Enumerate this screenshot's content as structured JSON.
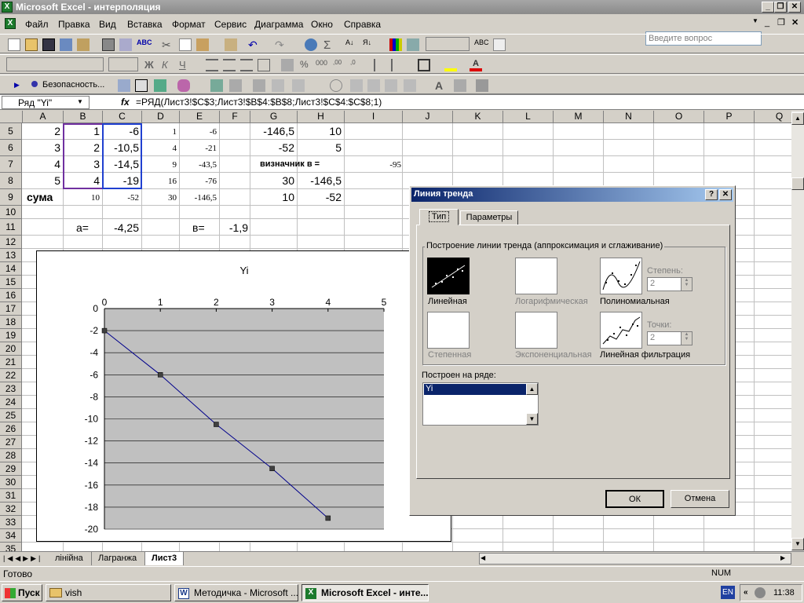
{
  "window": {
    "title": "Microsoft Excel - интерполяция"
  },
  "menu": [
    "Файл",
    "Правка",
    "Вид",
    "Вставка",
    "Формат",
    "Сервис",
    "Диаграмма",
    "Окно",
    "Справка"
  ],
  "help_placeholder": "Введите вопрос",
  "toolbar3": {
    "security": "Безопасность..."
  },
  "formula_bar": {
    "name": "Ряд \"Yi\"",
    "fx": "fx",
    "formula": "=РЯД(Лист3!$C$3;Лист3!$B$4:$B$8;Лист3!$C$4:$C$8;1)"
  },
  "columns": [
    "A",
    "B",
    "C",
    "D",
    "E",
    "F",
    "G",
    "H",
    "I",
    "J",
    "K",
    "L",
    "M",
    "N",
    "O",
    "P",
    "Q"
  ],
  "rows": [
    "5",
    "6",
    "7",
    "8",
    "9",
    "10",
    "11",
    "12",
    "13",
    "14",
    "15",
    "16",
    "17",
    "18",
    "19",
    "20",
    "21",
    "22",
    "23",
    "24",
    "25",
    "26",
    "27",
    "28",
    "29",
    "30",
    "31",
    "32",
    "33",
    "34",
    "35"
  ],
  "cells": {
    "a5": "2",
    "b5": "1",
    "c5": "-6",
    "d5": "1",
    "e5": "-6",
    "g5": "-146,5",
    "h5": "10",
    "a6": "3",
    "b6": "2",
    "c6": "-10,5",
    "d6": "4",
    "e6": "-21",
    "g6": "-52",
    "h6": "5",
    "a7": "4",
    "b7": "3",
    "c7": "-14,5",
    "d7": "9",
    "e7": "-43,5",
    "g7": "визначник в =",
    "i7": "-95",
    "a8": "5",
    "b8": "4",
    "c8": "-19",
    "d8": "16",
    "e8": "-76",
    "g8": "30",
    "h8": "-146,5",
    "a9": "сума",
    "b9": "10",
    "c9": "-52",
    "d9": "30",
    "e9": "-146,5",
    "g9": "10",
    "h9": "-52",
    "b11": "a=",
    "c11": "-4,25",
    "e11": "в=",
    "f11": "-1,9"
  },
  "chart_data": {
    "type": "line",
    "title": "Yi",
    "x": [
      0,
      1,
      2,
      3,
      4
    ],
    "series": [
      {
        "name": "Yi",
        "values": [
          -2,
          -6,
          -10.5,
          -14.5,
          -19
        ]
      }
    ],
    "xlim": [
      0,
      5
    ],
    "ylim": [
      -20,
      0
    ],
    "xticks": [
      "0",
      "1",
      "2",
      "3",
      "4",
      "5"
    ],
    "yticks": [
      "0",
      "-2",
      "-4",
      "-6",
      "-8",
      "-10",
      "-12",
      "-14",
      "-16",
      "-18",
      "-20"
    ],
    "grid": true,
    "colors": {
      "line": "#00008b",
      "plot_bg": "#c0c0c0",
      "marker": "#404040"
    }
  },
  "dialog": {
    "title": "Линия тренда",
    "tabs": [
      "Тип",
      "Параметры"
    ],
    "group_label": "Построение линии тренда (аппроксимация и сглаживание)",
    "types": [
      "Линейная",
      "Логарифмическая",
      "Полиномиальная",
      "Степенная",
      "Экспоненциальная",
      "Линейная фильтрация"
    ],
    "degree_label": "Степень:",
    "degree_value": "2",
    "points_label": "Точки:",
    "points_value": "2",
    "series_label": "Построен на ряде:",
    "series_items": [
      "Yi"
    ],
    "ok": "ОК",
    "cancel": "Отмена"
  },
  "sheet_tabs": [
    "лінійна",
    "Лагранжа",
    "Лист3"
  ],
  "status": {
    "left": "Готово",
    "num": "NUM"
  },
  "taskbar": {
    "start": "Пуск",
    "items": [
      "vish",
      "Методичка - Microsoft ...",
      "Microsoft Excel - инте..."
    ],
    "lang": "EN",
    "time": "11:38"
  }
}
